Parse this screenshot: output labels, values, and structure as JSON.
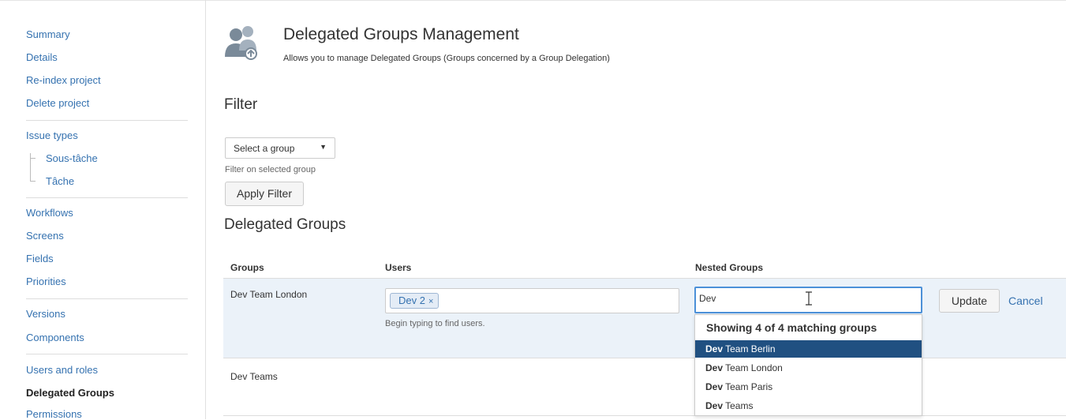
{
  "sidebar": {
    "items": [
      {
        "label": "Summary"
      },
      {
        "label": "Details"
      },
      {
        "label": "Re-index project"
      },
      {
        "label": "Delete project"
      },
      {
        "label": "Issue types"
      },
      {
        "label": "Sous-tâche"
      },
      {
        "label": "Tâche"
      },
      {
        "label": "Workflows"
      },
      {
        "label": "Screens"
      },
      {
        "label": "Fields"
      },
      {
        "label": "Priorities"
      },
      {
        "label": "Versions"
      },
      {
        "label": "Components"
      },
      {
        "label": "Users and roles"
      },
      {
        "label": "Delegated Groups"
      },
      {
        "label": "Permissions"
      }
    ],
    "active": "Delegated Groups"
  },
  "header": {
    "icon": "users-group-icon",
    "title": "Delegated Groups Management",
    "description": "Allows you to manage Delegated Groups (Groups concerned by a Group Delegation)"
  },
  "filter": {
    "heading": "Filter",
    "select_value": "Select a group",
    "select_caret": "▼",
    "helper": "Filter on selected group",
    "apply_label": "Apply Filter"
  },
  "delegated": {
    "heading": "Delegated Groups",
    "columns": [
      "Groups",
      "Users",
      "Nested Groups"
    ],
    "rows": [
      {
        "group": "Dev Team London",
        "users": [
          "Dev 2"
        ],
        "users_hint": "Begin typing to find users.",
        "nested_input": "Dev"
      },
      {
        "group": "Dev Teams"
      }
    ],
    "update_label": "Update",
    "cancel_label": "Cancel",
    "remove_glyph": "×"
  },
  "autocomplete": {
    "header": "Showing 4 of 4 matching groups",
    "query": "Dev",
    "items": [
      {
        "match": "Dev",
        "rest": " Team Berlin",
        "selected": true
      },
      {
        "match": "Dev",
        "rest": " Team London",
        "selected": false
      },
      {
        "match": "Dev",
        "rest": " Team Paris",
        "selected": false
      },
      {
        "match": "Dev",
        "rest": " Teams",
        "selected": false
      }
    ]
  },
  "colors": {
    "link": "#3572b0",
    "row_highlight": "#ebf2f9",
    "selected_item": "#205081",
    "focus_border": "#4c90d8"
  }
}
